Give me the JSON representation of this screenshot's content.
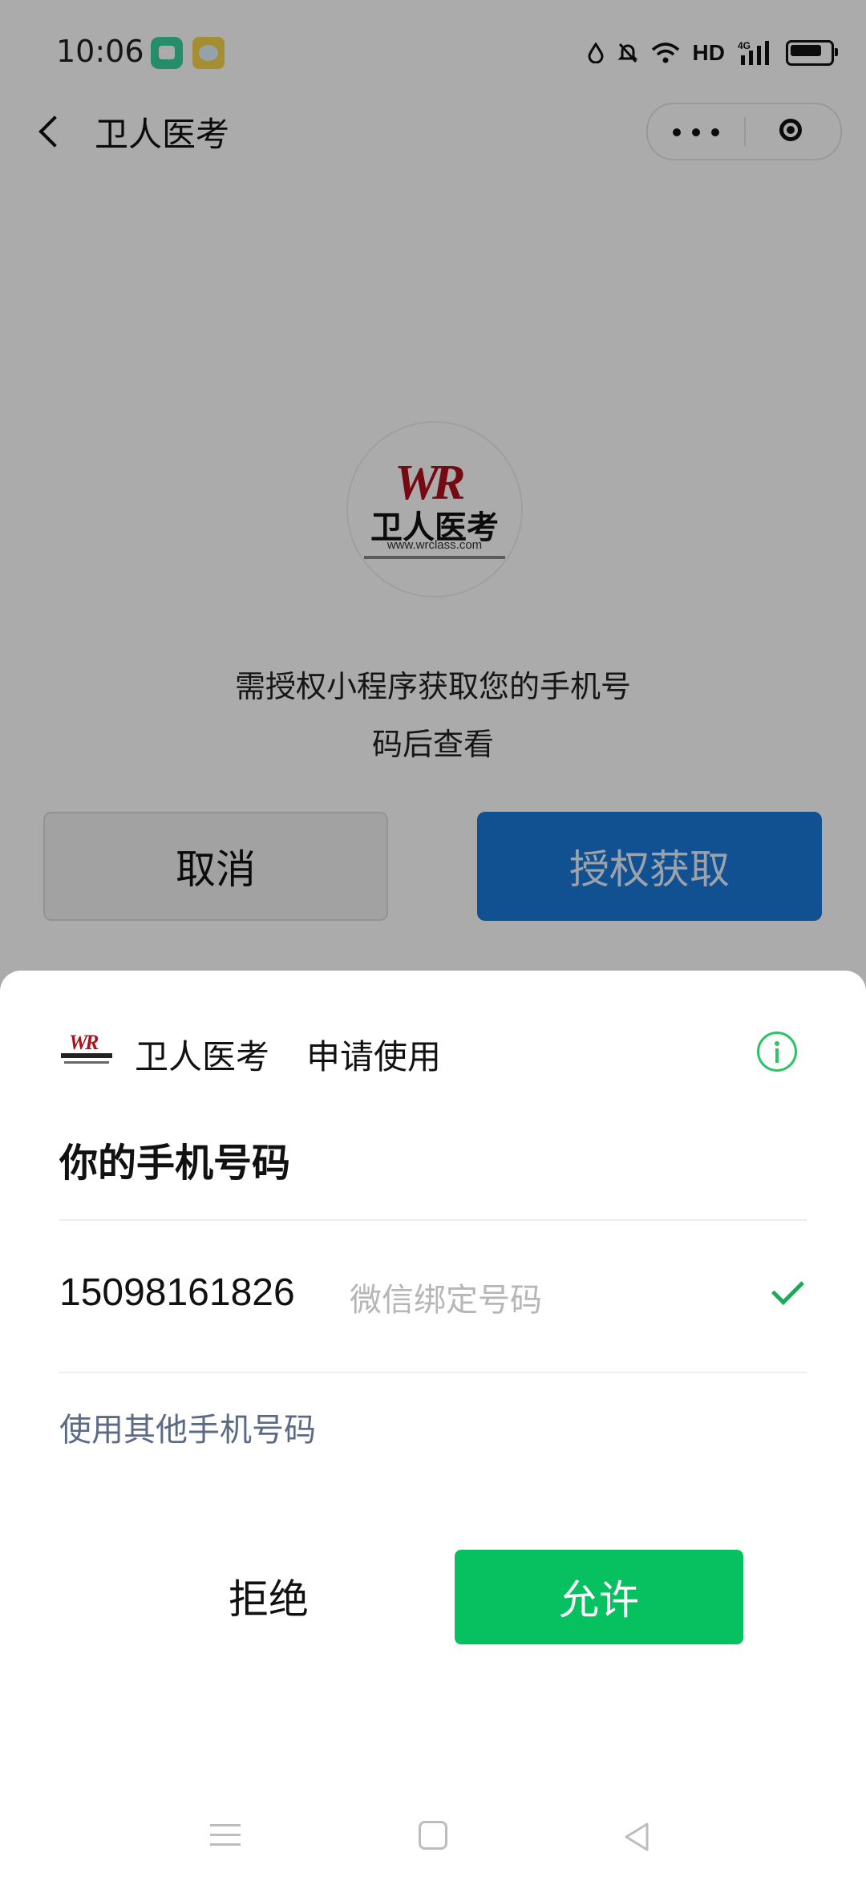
{
  "status_bar": {
    "time": "10:06",
    "network_label": "HD",
    "network_type": "4G"
  },
  "nav": {
    "title": "卫人医考"
  },
  "logo": {
    "mark": "WR",
    "name": "卫人医考",
    "url": "www.wrclass.com"
  },
  "prompt": {
    "line1": "需授权小程序获取您的手机号",
    "line2": "码后查看"
  },
  "actions": {
    "cancel": "取消",
    "authorize": "授权获取"
  },
  "sheet": {
    "app_name": "卫人医考",
    "request_text": "申请使用",
    "title": "你的手机号码",
    "phone_number": "15098161826",
    "phone_tag": "微信绑定号码",
    "other_phone": "使用其他手机号码",
    "deny": "拒绝",
    "allow": "允许"
  },
  "colors": {
    "allow_green": "#07c160",
    "authorize_blue": "#1a7ad8",
    "brand_red": "#b0101c"
  }
}
